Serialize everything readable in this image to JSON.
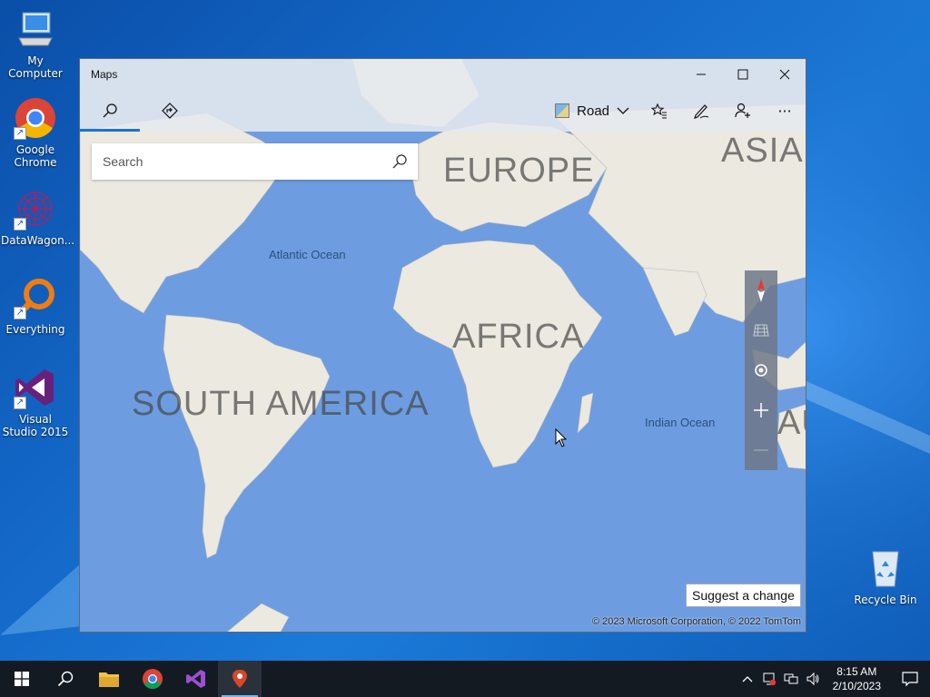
{
  "desktop": {
    "icons": [
      {
        "label": "My Computer"
      },
      {
        "label": "Google Chrome"
      },
      {
        "label": "DataWagon..."
      },
      {
        "label": "Everything"
      },
      {
        "label": "Visual Studio 2015"
      },
      {
        "label": "Recycle Bin"
      }
    ]
  },
  "window": {
    "title": "Maps",
    "controls": {
      "minimize": "—",
      "maximize": "☐",
      "close": "✕"
    }
  },
  "toolbar": {
    "tabs": [
      {
        "name": "search",
        "icon": "search-icon"
      },
      {
        "name": "directions",
        "icon": "directions-icon"
      }
    ],
    "view_label": "Road",
    "buttons": [
      "favorites-icon",
      "ink-icon",
      "account-icon",
      "more-icon"
    ],
    "more_label": "···"
  },
  "search": {
    "placeholder": "Search",
    "value": ""
  },
  "map": {
    "labels": {
      "europe": "EUROPE",
      "asia": "ASIA",
      "africa": "AFRICA",
      "south_america": "SOUTH AMERICA",
      "australia_partial": "AU",
      "atlantic": "Atlantic Ocean",
      "indian": "Indian Ocean"
    },
    "suggest_label": "Suggest a change",
    "copyright": "© 2023 Microsoft Corporation, © 2022 TomTom"
  },
  "colors": {
    "ocean": "#6d9de0",
    "land": "#ece9e1",
    "accent": "#1a73d8"
  },
  "taskbar": {
    "apps": [
      "start-icon",
      "search-icon",
      "file-explorer-icon",
      "chrome-icon",
      "visual-studio-icon",
      "maps-icon"
    ],
    "clock": {
      "time": "8:15 AM",
      "date": "2/10/2023"
    }
  }
}
